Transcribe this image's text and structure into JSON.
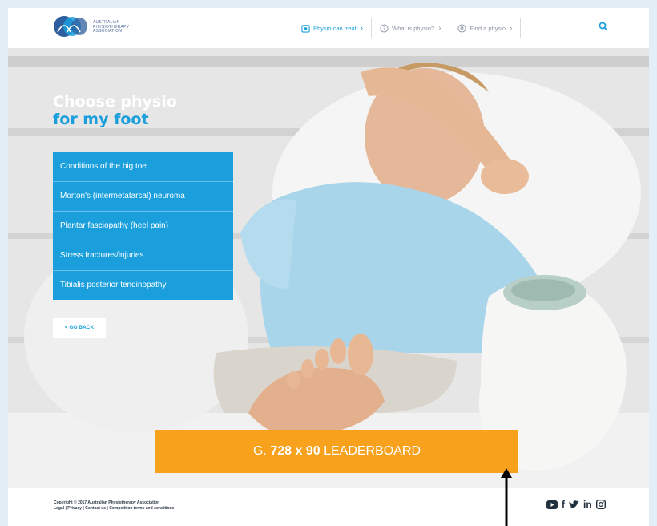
{
  "logo": {
    "lines": [
      "AUSTRALIAN",
      "PHYSIOTHERAPY",
      "ASSOCIATION"
    ],
    "mark_icon": "apa-logo-mark"
  },
  "nav": {
    "items": [
      {
        "label": "Physio can treat",
        "icon": "physio-icon",
        "active": true
      },
      {
        "label": "What is physio?",
        "icon": "question-icon",
        "active": false
      },
      {
        "label": "Find a physio",
        "icon": "location-icon",
        "active": false
      }
    ],
    "search_icon": "search-icon"
  },
  "hero": {
    "title_line1": "Choose physio",
    "title_line2": "for my foot",
    "menu": [
      "Conditions of the big toe",
      "Morton's (intermetatarsal) neuroma",
      "Plantar fasciopathy (heel pain)",
      "Stress fractures/injuries",
      "Tibialis posterior tendinopathy"
    ],
    "back_label": "< GO BACK"
  },
  "leaderboard": {
    "prefix": "G.",
    "size": "728 x 90",
    "label": "LEADERBOARD"
  },
  "footer": {
    "copyright": "Copyright © 2017 Australian Physiotherapy Association",
    "links": "Legal | Privacy | Contact us | Competition terms and conditions",
    "social_icons": [
      "youtube-icon",
      "facebook-icon",
      "twitter-icon",
      "linkedin-icon",
      "instagram-icon"
    ]
  },
  "colors": {
    "accent_blue": "#1a9fdc",
    "leaderboard_orange": "#f7a11d",
    "background": "#e3eef7"
  }
}
